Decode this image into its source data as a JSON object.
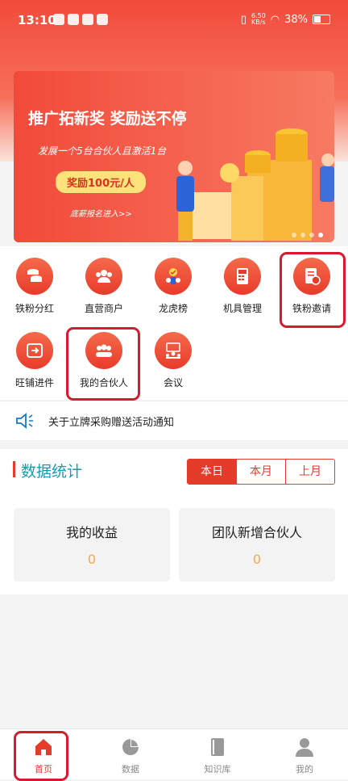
{
  "status_bar": {
    "time": "13:10",
    "net_speed_value": "6.50",
    "net_speed_unit": "KB/s",
    "battery": "38%"
  },
  "banner": {
    "title": "推广拓新奖 奖励送不停",
    "subtitle": "发展一个5台合伙人且激活1台",
    "reward": "奖励100元/人",
    "footer": "底薪报名进入>>",
    "active_dot": 4,
    "dot_count": 4
  },
  "menu": {
    "items": [
      {
        "label": "铁粉分红",
        "icon": "coins-icon"
      },
      {
        "label": "直营商户",
        "icon": "people-icon"
      },
      {
        "label": "龙虎榜",
        "icon": "ranking-icon"
      },
      {
        "label": "机具管理",
        "icon": "pos-terminal-icon"
      },
      {
        "label": "铁粉邀请",
        "icon": "invite-icon"
      },
      {
        "label": "旺铺进件",
        "icon": "scan-icon"
      },
      {
        "label": "我的合伙人",
        "icon": "partners-icon"
      },
      {
        "label": "会议",
        "icon": "meeting-icon"
      }
    ]
  },
  "notice": {
    "text": "关于立牌采购赠送活动通知"
  },
  "stats": {
    "title": "数据统计",
    "tabs": [
      "本日",
      "本月",
      "上月"
    ],
    "selected_tab": "本日",
    "cards": [
      {
        "label": "我的收益",
        "value": "0"
      },
      {
        "label": "团队新增合伙人",
        "value": "0"
      }
    ]
  },
  "bottom_nav": {
    "items": [
      {
        "label": "首页",
        "icon": "home-icon"
      },
      {
        "label": "数据",
        "icon": "pie-chart-icon"
      },
      {
        "label": "知识库",
        "icon": "book-icon"
      },
      {
        "label": "我的",
        "icon": "user-icon"
      }
    ],
    "active": "首页"
  },
  "colors": {
    "accent": "#e53b2a",
    "stats_title": "#1a9aaf",
    "value": "#f5a94a",
    "highlight_box": "#d8192f"
  }
}
